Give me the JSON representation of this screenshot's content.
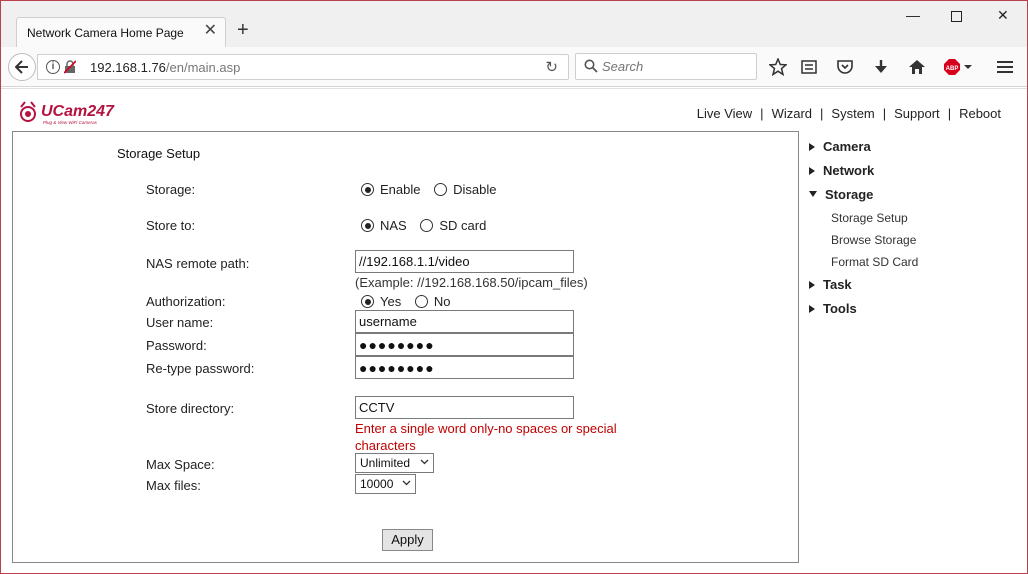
{
  "browser": {
    "tab_title": "Network Camera Home Page",
    "url_host": "192.168.1.76",
    "url_path": "/en/main.asp",
    "search_placeholder": "Search",
    "adblock_label": "ABP"
  },
  "nav": {
    "items": [
      "Live View",
      "Wizard",
      "System",
      "Support",
      "Reboot"
    ]
  },
  "logo": {
    "text": "UCam247",
    "tagline": "Plug & View WiFi Cameras"
  },
  "form": {
    "title": "Storage Setup",
    "storage": {
      "label": "Storage:",
      "opt1": "Enable",
      "opt2": "Disable",
      "selected": "Enable"
    },
    "store_to": {
      "label": "Store to:",
      "opt1": "NAS",
      "opt2": "SD card",
      "selected": "NAS"
    },
    "nas_path": {
      "label": "NAS remote path:",
      "value": "//192.168.1.1/video",
      "example": "(Example: //192.168.168.50/ipcam_files)"
    },
    "authorization": {
      "label": "Authorization:",
      "opt1": "Yes",
      "opt2": "No",
      "selected": "Yes"
    },
    "username": {
      "label": "User name:",
      "value": "username"
    },
    "password": {
      "label": "Password:",
      "value": "●●●●●●●●"
    },
    "retype": {
      "label": "Re-type password:",
      "value": "●●●●●●●●"
    },
    "store_dir": {
      "label": "Store directory:",
      "value": "CCTV",
      "error": "Enter a single word only-no spaces or special characters"
    },
    "max_space": {
      "label": "Max Space:",
      "value": "Unlimited"
    },
    "max_files": {
      "label": "Max files:",
      "value": "10000"
    },
    "apply_label": "Apply"
  },
  "menu": {
    "camera": "Camera",
    "network": "Network",
    "storage": "Storage",
    "storage_sub": [
      "Storage Setup",
      "Browse Storage",
      "Format SD Card"
    ],
    "task": "Task",
    "tools": "Tools"
  },
  "colors": {
    "error": "#c00000",
    "logo": "#b5123f",
    "window_border": "#b9424a"
  }
}
